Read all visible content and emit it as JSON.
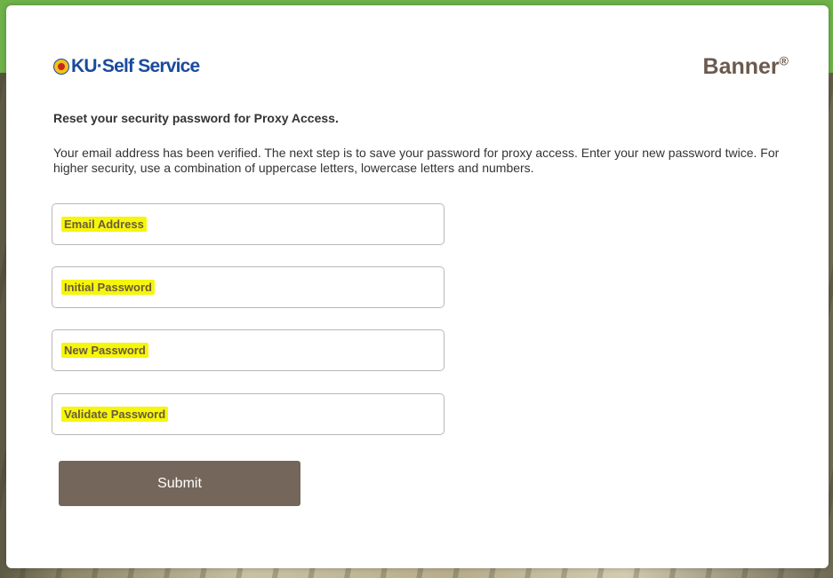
{
  "header": {
    "logo_text": "KU·Self Service",
    "brand_name": "Banner",
    "brand_mark": "®"
  },
  "main": {
    "heading": "Reset your security password for Proxy Access.",
    "description": "Your email address has been verified. The next step is to save your password for proxy access. Enter your new password twice. For higher security, use a combination of uppercase letters, lowercase letters and numbers."
  },
  "form": {
    "email_label": "Email Address",
    "initial_password_label": "Initial Password",
    "new_password_label": "New Password",
    "validate_password_label": "Validate Password",
    "submit_label": "Submit"
  },
  "colors": {
    "brand_brown": "#6b5a4d",
    "button_bg": "#74665a",
    "highlight": "#f6f60a",
    "logo_blue": "#1a4a9c",
    "top_green": "#6fb24a"
  }
}
